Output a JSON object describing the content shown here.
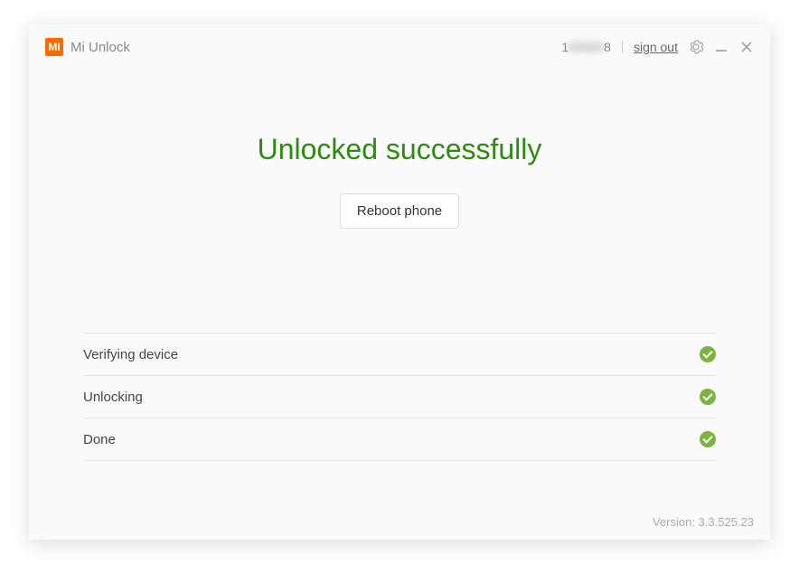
{
  "header": {
    "logo_text": "MI",
    "app_title": "Mi Unlock",
    "account_prefix": "1",
    "account_suffix": "8",
    "sign_out_label": "sign out"
  },
  "main": {
    "headline": "Unlocked successfully",
    "reboot_label": "Reboot phone"
  },
  "steps": [
    {
      "label": "Verifying device",
      "status": "done"
    },
    {
      "label": "Unlocking",
      "status": "done"
    },
    {
      "label": "Done",
      "status": "done"
    }
  ],
  "footer": {
    "version_prefix": "Version: ",
    "version_value": "3.3.525.23"
  },
  "colors": {
    "success_text": "#2e8b11",
    "success_icon": "#7cb342",
    "brand": "#ff6700"
  }
}
